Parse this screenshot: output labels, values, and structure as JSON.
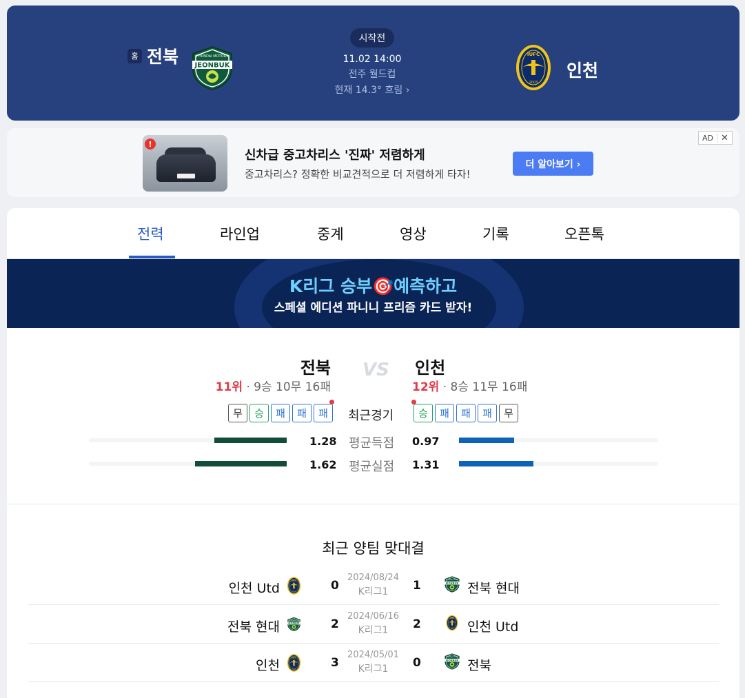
{
  "match": {
    "home": {
      "tag": "홈",
      "name": "전북",
      "logo": "jeonbuk-logo-icon"
    },
    "away": {
      "name": "인천",
      "logo": "incheon-logo-icon"
    },
    "status": "시작전",
    "kickoff": "11.02 14:00",
    "stadium": "전주 월드컵",
    "weather": "현재 14.3° 흐림 ›"
  },
  "ad": {
    "title": "신차급 중고차리스 '진짜' 저렴하게",
    "desc": "중고차리스? 정확한 비교견적으로 더 저렴하게 타자!",
    "cta": "더 알아보기 ›",
    "alert": "!",
    "tag": "AD",
    "close": "✕"
  },
  "tabs": [
    "전력",
    "라인업",
    "중계",
    "영상",
    "기록",
    "오픈톡"
  ],
  "promo": {
    "line1": "K리그 승부🎯예측하고",
    "line2": "스페셜 에디션 파니니 프리즘 카드 받자!"
  },
  "comparison": {
    "home": {
      "name": "전북",
      "rank": "11위",
      "record": " · 9승 10무 16패",
      "form": [
        "무",
        "승",
        "패",
        "패",
        "패"
      ]
    },
    "away": {
      "name": "인천",
      "rank": "12위",
      "record": " · 8승 11무 16패",
      "form": [
        "승",
        "패",
        "패",
        "패",
        "무"
      ]
    },
    "vs": "VS",
    "form_label": "최근경기",
    "stats": [
      {
        "label": "평균득점",
        "home": "1.28",
        "away": "0.97"
      },
      {
        "label": "평균실점",
        "home": "1.62",
        "away": "1.31"
      }
    ]
  },
  "h2h": {
    "title": "최근 양팀 맞대결",
    "rows": [
      {
        "home": "인천 Utd",
        "home_score": "0",
        "date": "2024/08/24",
        "comp": "K리그1",
        "away_score": "1",
        "away": "전북 현대"
      },
      {
        "home": "전북 현대",
        "home_score": "2",
        "date": "2024/06/16",
        "comp": "K리그1",
        "away_score": "2",
        "away": "인천 Utd"
      },
      {
        "home": "인천",
        "home_score": "3",
        "date": "2024/05/01",
        "comp": "K리그1",
        "away_score": "0",
        "away": "전북"
      }
    ]
  },
  "colors": {
    "header_bg": "#27417f",
    "accent": "#2b59c3",
    "rank": "#e03b4a",
    "home_bar": "#124c3b",
    "away_bar": "#0e63b7"
  }
}
